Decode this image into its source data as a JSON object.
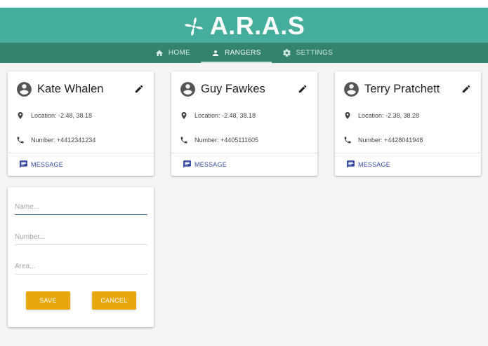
{
  "app": {
    "title": "A.R.A.S",
    "logo_icon": "pinwheel-icon"
  },
  "nav": {
    "tabs": [
      {
        "label": "HOME",
        "icon": "home-icon",
        "active": false
      },
      {
        "label": "RANGERS",
        "icon": "person-icon",
        "active": true
      },
      {
        "label": "SETTINGS",
        "icon": "gear-icon",
        "active": false
      }
    ]
  },
  "rangers": [
    {
      "name": "Kate Whalen",
      "location": "Location: -2.48, 38.18",
      "number": "Number: +4412341234",
      "message_label": "MESSAGE"
    },
    {
      "name": "Guy Fawkes",
      "location": "Location: -2.48, 38.18",
      "number": "Number: +4405111605",
      "message_label": "MESSAGE"
    },
    {
      "name": "Terry Pratchett",
      "location": "Location: -2.38, 38.28",
      "number": "Number: +4428041948",
      "message_label": "MESSAGE"
    }
  ],
  "form": {
    "name_placeholder": "Name...",
    "number_placeholder": "Number...",
    "area_placeholder": "Area...",
    "save_label": "SAVE",
    "cancel_label": "CANCEL"
  },
  "colors": {
    "header": "#45ad9b",
    "nav": "#34836f",
    "accent_button": "#e6a80d",
    "message_link": "#3649a2",
    "focus_underline": "#3a5ea3"
  }
}
